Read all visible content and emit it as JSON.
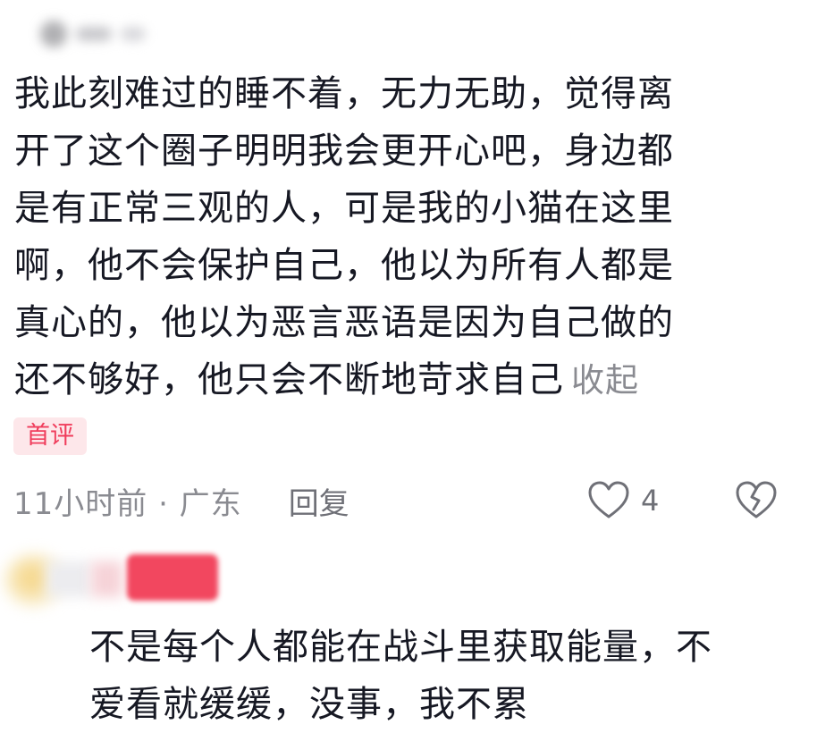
{
  "comment": {
    "text": "我此刻难过的睡不着，无力无助，觉得离\n开了这个圈子明明我会更开心吧，身边都\n是有正常三观的人，可是我的小猫在这里\n啊，他不会保护自己，他以为所有人都是\n真心的，他以为恶言恶语是因为自己做的\n还不够好，他只会不断地苛求自己",
    "collapse_label": "收起",
    "badge": "首评",
    "time_location": "11小时前 · 广东",
    "reply_label": "回复",
    "like_count": "4",
    "icons": {
      "like": "heart-outline-icon",
      "dislike": "broken-heart-icon"
    }
  },
  "reply": {
    "text": "不是每个人都能在战斗里获取能量，不\n爱看就缓缓，没事，我不累"
  },
  "colors": {
    "text": "#161823",
    "meta": "#8a8b91",
    "badge_bg": "#fde7ea",
    "badge_text": "#f03d5c",
    "username_highlight": "#f2475f"
  }
}
